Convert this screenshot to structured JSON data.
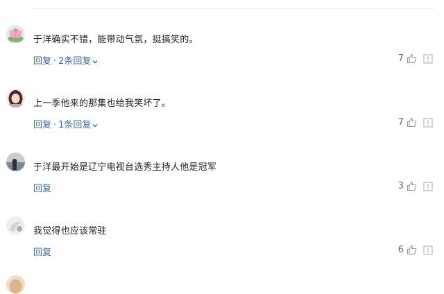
{
  "comments": [
    {
      "text": "于洋确实不错，能带动气氛，挺搞笑的。",
      "reply_label": "回复",
      "separator": "·",
      "replies_label": "2条回复",
      "likes": "7",
      "avatar": "lotus-avatar-icon"
    },
    {
      "text": "上一季他来的那集也给我笑坏了。",
      "reply_label": "回复",
      "separator": "·",
      "replies_label": "1条回复",
      "likes": "7",
      "avatar": "girl-avatar-icon"
    },
    {
      "text": "于洋最开始是辽宁电视台选秀主持人他是冠军",
      "reply_label": "回复",
      "likes": "3",
      "avatar": "dark-photo-avatar-icon"
    },
    {
      "text": "我觉得也应该常驻",
      "reply_label": "回复",
      "likes": "6",
      "avatar": "white-photo-avatar-icon"
    }
  ],
  "colors": {
    "link": "#3b6ba5",
    "text": "#222222",
    "muted": "#666666"
  }
}
